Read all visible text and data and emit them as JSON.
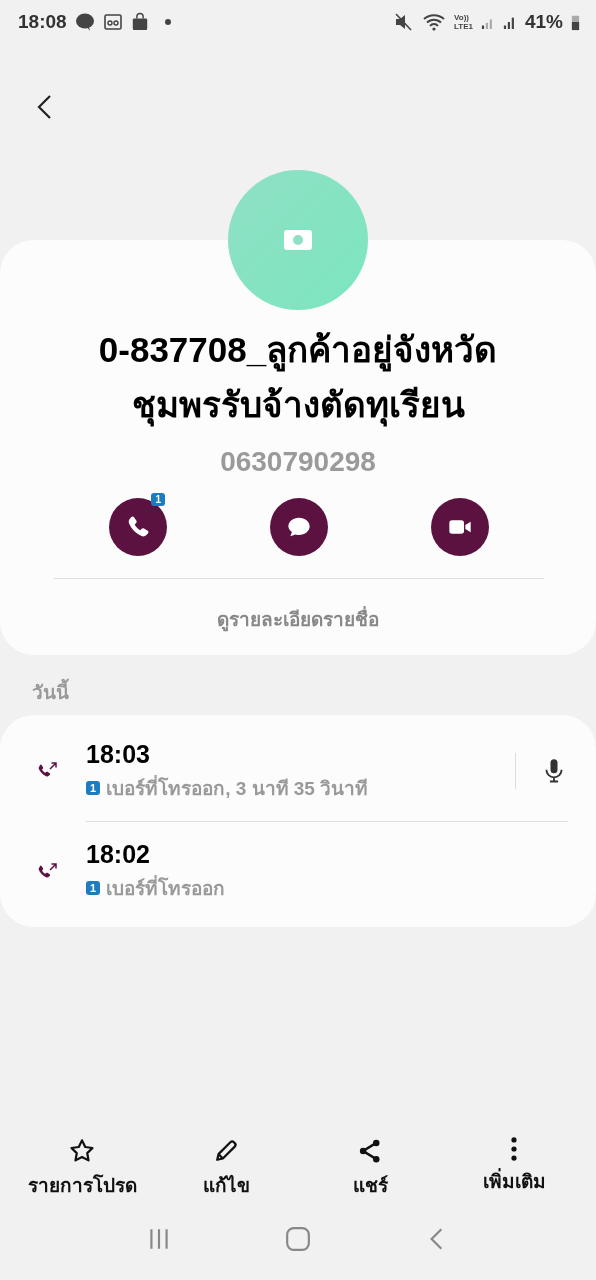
{
  "status_bar": {
    "time": "18:08",
    "network": [
      "Vo))",
      "LTE1"
    ],
    "battery": "41%"
  },
  "contact": {
    "name": "0-837708_ลูกค้าอยู่จังหวัดชุมพรรับจ้างตัดทุเรียน",
    "number": "0630790298",
    "actions": [
      {
        "kind": "call",
        "badge": "1"
      },
      {
        "kind": "message"
      },
      {
        "kind": "video"
      }
    ],
    "details_link": "ดูรายละเอียดรายชื่อ"
  },
  "section_label": "วันนี้",
  "call_log": [
    {
      "kind": "outgoing",
      "time": "18:03",
      "sim": "1",
      "description": "เบอร์ที่โทรออก, 3 นาที 35 วินาที",
      "recording": true
    },
    {
      "kind": "outgoing",
      "time": "18:02",
      "sim": "1",
      "description": "เบอร์ที่โทรออก",
      "recording": false
    }
  ],
  "bottom_actions": [
    {
      "kind": "favorite",
      "label": "รายการโปรด"
    },
    {
      "kind": "edit",
      "label": "แก้ไข"
    },
    {
      "kind": "share",
      "label": "แชร์"
    },
    {
      "kind": "more",
      "label": "เพิ่มเติม"
    }
  ]
}
